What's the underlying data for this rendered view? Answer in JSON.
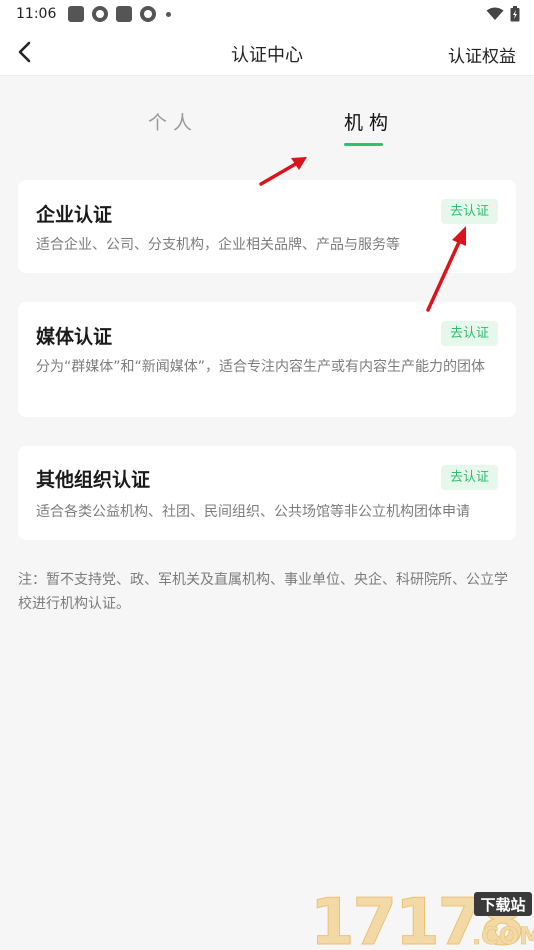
{
  "statusbar": {
    "time": "11:06"
  },
  "navbar": {
    "title": "认证中心",
    "right_label": "认证权益"
  },
  "tabs": [
    {
      "label": "个人",
      "active": false
    },
    {
      "label": "机构",
      "active": true
    }
  ],
  "cards": [
    {
      "title": "企业认证",
      "desc": "适合企业、公司、分支机构，企业相关品牌、产品与服务等",
      "button": "去认证"
    },
    {
      "title": "媒体认证",
      "desc": "分为“群媒体”和“新闻媒体”，适合专注内容生产或有内容生产能力的团体",
      "button": "去认证"
    },
    {
      "title": "其他组织认证",
      "desc": "适合各类公益机构、社团、民间组织、公共场馆等非公立机构团体申请",
      "button": "去认证"
    }
  ],
  "note": "注：暂不支持党、政、军机关及直属机构、事业单位、央企、科研院所、公立学校进行机构认证。",
  "watermark": {
    "number": "17178",
    "badge": "下载站",
    "domain": ".COM"
  },
  "colors": {
    "accent": "#2fbf6e",
    "accent_bg": "#e6f7ec",
    "arrow": "#d9141c",
    "page_bg": "#f6f6f6"
  }
}
